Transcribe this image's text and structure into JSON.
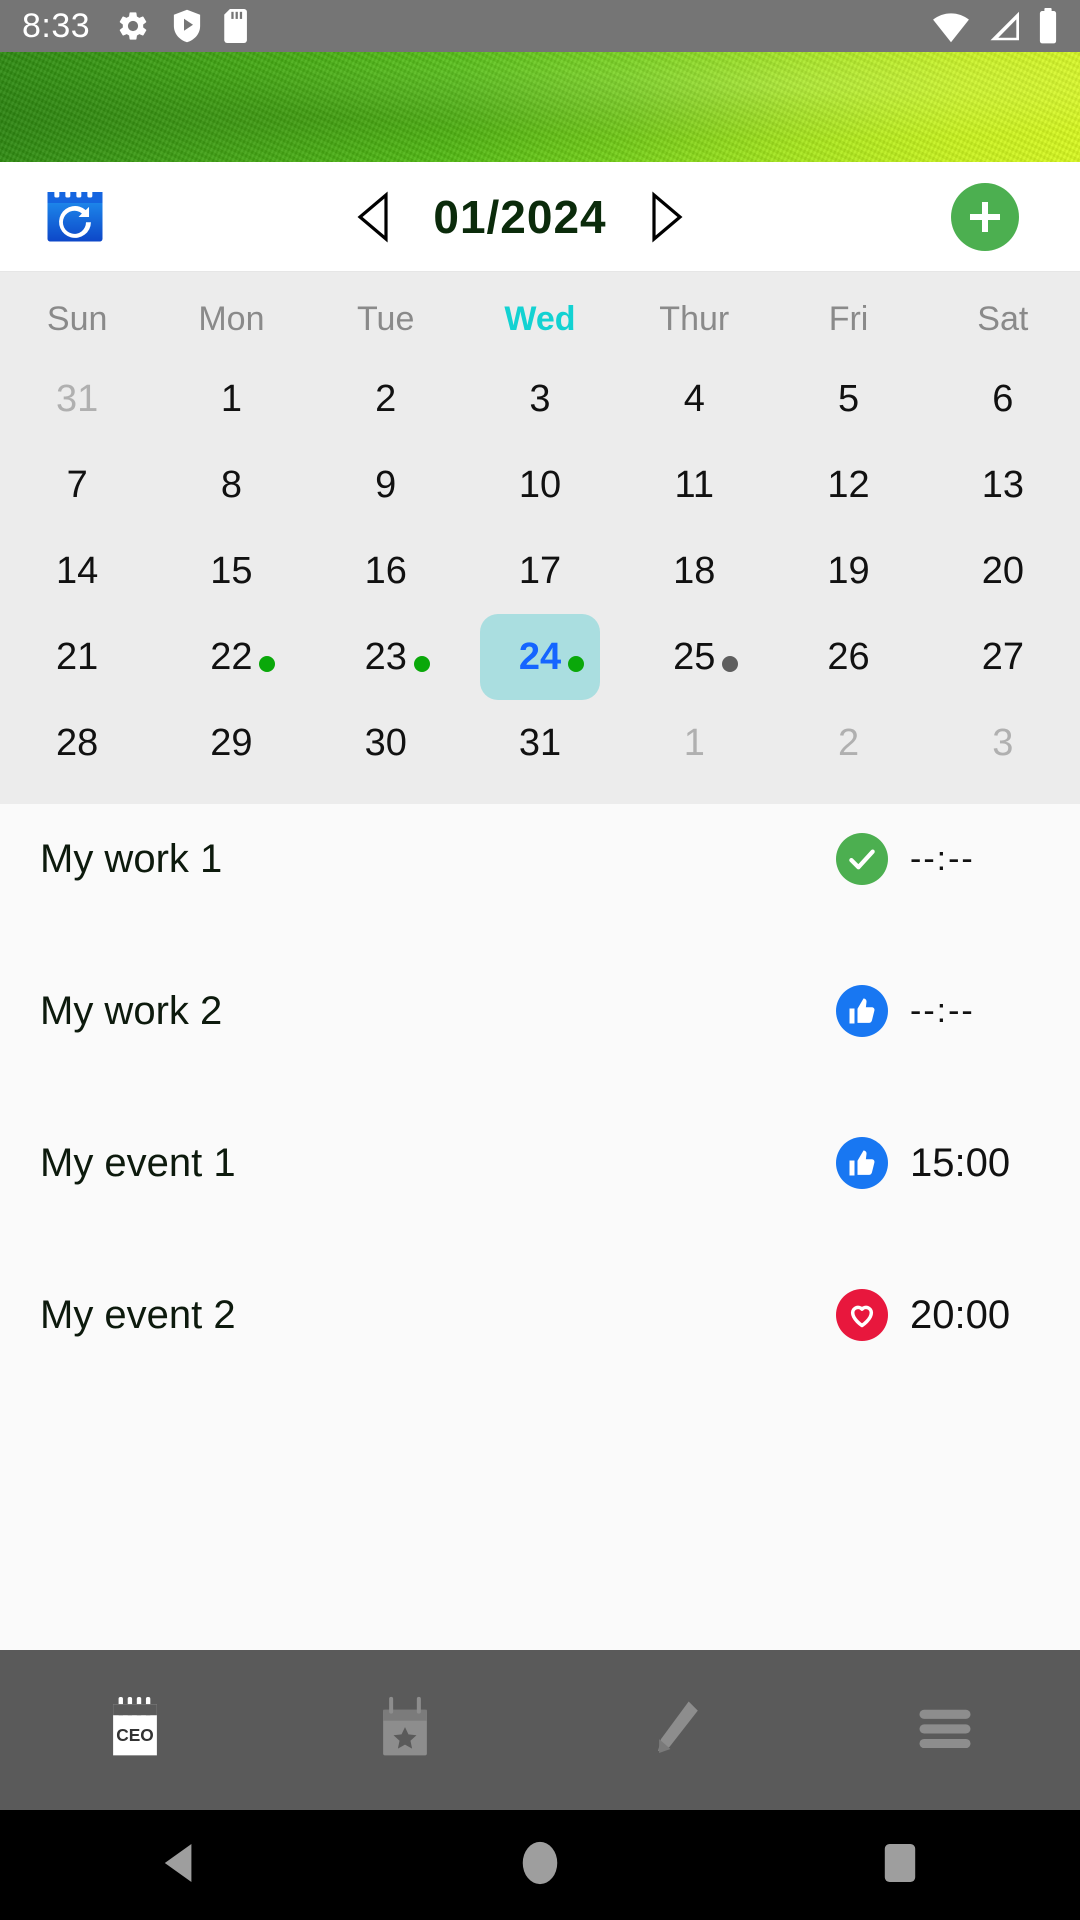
{
  "status_bar": {
    "time": "8:33",
    "left_icons": [
      "gear-icon",
      "play-protect-icon",
      "sd-card-icon"
    ],
    "right_icons": [
      "wifi-icon",
      "cellular-signal-icon",
      "battery-icon"
    ],
    "background_color": "#757575"
  },
  "banner": {
    "name": "green-texture-banner",
    "gradient_from": "#2e8b12",
    "gradient_to": "#d9fa20"
  },
  "toolbar": {
    "today_button_label": "today-calendar-icon",
    "prev_label": "◁",
    "next_label": "▷",
    "month_title": "01/2024",
    "add_button_label": "+",
    "add_button_color": "#4caf50",
    "title_color": "#0b2b0b"
  },
  "calendar": {
    "highlight_weekday": "Wed",
    "highlight_weekday_color": "#13d2d2",
    "selected_day": "24",
    "selected_bg": "#aadee0",
    "selected_text_color": "#1565ff",
    "weekdays": [
      "Sun",
      "Mon",
      "Tue",
      "Wed",
      "Thur",
      "Fri",
      "Sat"
    ],
    "weeks": [
      [
        {
          "day": "31",
          "muted": true,
          "dot": null
        },
        {
          "day": "1",
          "muted": false,
          "dot": null
        },
        {
          "day": "2",
          "muted": false,
          "dot": null
        },
        {
          "day": "3",
          "muted": false,
          "dot": null
        },
        {
          "day": "4",
          "muted": false,
          "dot": null
        },
        {
          "day": "5",
          "muted": false,
          "dot": null
        },
        {
          "day": "6",
          "muted": false,
          "dot": null
        }
      ],
      [
        {
          "day": "7",
          "muted": false,
          "dot": null
        },
        {
          "day": "8",
          "muted": false,
          "dot": null
        },
        {
          "day": "9",
          "muted": false,
          "dot": null
        },
        {
          "day": "10",
          "muted": false,
          "dot": null
        },
        {
          "day": "11",
          "muted": false,
          "dot": null
        },
        {
          "day": "12",
          "muted": false,
          "dot": null
        },
        {
          "day": "13",
          "muted": false,
          "dot": null
        }
      ],
      [
        {
          "day": "14",
          "muted": false,
          "dot": null
        },
        {
          "day": "15",
          "muted": false,
          "dot": null
        },
        {
          "day": "16",
          "muted": false,
          "dot": null
        },
        {
          "day": "17",
          "muted": false,
          "dot": null
        },
        {
          "day": "18",
          "muted": false,
          "dot": null
        },
        {
          "day": "19",
          "muted": false,
          "dot": null
        },
        {
          "day": "20",
          "muted": false,
          "dot": null
        }
      ],
      [
        {
          "day": "21",
          "muted": false,
          "dot": null
        },
        {
          "day": "22",
          "muted": false,
          "dot": "green"
        },
        {
          "day": "23",
          "muted": false,
          "dot": "green"
        },
        {
          "day": "24",
          "muted": false,
          "dot": "green",
          "selected": true
        },
        {
          "day": "25",
          "muted": false,
          "dot": "gray"
        },
        {
          "day": "26",
          "muted": false,
          "dot": null
        },
        {
          "day": "27",
          "muted": false,
          "dot": null
        }
      ],
      [
        {
          "day": "28",
          "muted": false,
          "dot": null
        },
        {
          "day": "29",
          "muted": false,
          "dot": null
        },
        {
          "day": "30",
          "muted": false,
          "dot": null
        },
        {
          "day": "31",
          "muted": false,
          "dot": null
        },
        {
          "day": "1",
          "muted": true,
          "dot": null
        },
        {
          "day": "2",
          "muted": true,
          "dot": null
        },
        {
          "day": "3",
          "muted": true,
          "dot": null
        }
      ]
    ]
  },
  "events": [
    {
      "title": "My work 1",
      "icon": "check-circle-icon",
      "icon_color": "#4caf50",
      "time": "--:--",
      "time_placeholder": true
    },
    {
      "title": "My work 2",
      "icon": "thumbs-up-icon",
      "icon_color": "#1877f2",
      "time": "--:--",
      "time_placeholder": true
    },
    {
      "title": "My event 1",
      "icon": "thumbs-up-icon",
      "icon_color": "#1877f2",
      "time": "15:00",
      "time_placeholder": false
    },
    {
      "title": "My event 2",
      "icon": "heart-icon",
      "icon_color": "#e8173d",
      "time": "20:00",
      "time_placeholder": false
    }
  ],
  "bottom_nav": {
    "background_color": "#5a5a5a",
    "items": [
      {
        "name": "ceo-calendar-tab",
        "icon": "calendar-ceo-icon",
        "label": "CEO",
        "active": true
      },
      {
        "name": "star-calendar-tab",
        "icon": "calendar-star-icon",
        "label": "",
        "active": false
      },
      {
        "name": "edit-tab",
        "icon": "pencil-icon",
        "label": "",
        "active": false
      },
      {
        "name": "menu-tab",
        "icon": "hamburger-menu-icon",
        "label": "",
        "active": false
      }
    ]
  },
  "system_nav": {
    "back": "back-triangle-icon",
    "home": "home-circle-icon",
    "recents": "recents-square-icon"
  }
}
